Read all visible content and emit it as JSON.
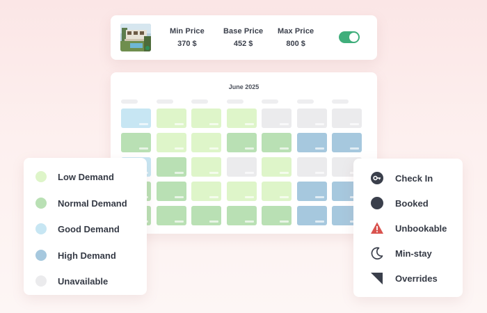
{
  "prices": {
    "min": {
      "label": "Min Price",
      "value": "370 $"
    },
    "base": {
      "label": "Base Price",
      "value": "452 $"
    },
    "max": {
      "label": "Max Price",
      "value": "800 $"
    },
    "toggle_on": true
  },
  "calendar": {
    "title": "June 2025",
    "rows": [
      [
        "good",
        "low",
        "low",
        "low",
        "unavailable",
        "unavailable",
        "unavailable"
      ],
      [
        "normal",
        "low",
        "low",
        "normal",
        "normal",
        "high",
        "high"
      ],
      [
        "good",
        "normal",
        "low",
        "unavailable",
        "low",
        "unavailable",
        "unavailable"
      ],
      [
        "normal",
        "normal",
        "low",
        "low",
        "low",
        "high",
        "high"
      ],
      [
        "normal",
        "normal",
        "normal",
        "normal",
        "normal",
        "high",
        "high"
      ]
    ]
  },
  "legend": {
    "demand": [
      {
        "key": "low",
        "label": "Low Demand",
        "color": "#def5c9"
      },
      {
        "key": "normal",
        "label": "Normal Demand",
        "color": "#b9e0b4"
      },
      {
        "key": "good",
        "label": "Good Demand",
        "color": "#c7e6f3"
      },
      {
        "key": "high",
        "label": "High Demand",
        "color": "#a6c8de"
      },
      {
        "key": "unavailable",
        "label": "Unavailable",
        "color": "#ebebed"
      }
    ],
    "status": [
      {
        "label": "Check In",
        "icon": "check-in-icon"
      },
      {
        "label": "Booked",
        "icon": "booked-icon"
      },
      {
        "label": "Unbookable",
        "icon": "warning-icon"
      },
      {
        "label": "Min-stay",
        "icon": "moon-icon"
      },
      {
        "label": "Overrides",
        "icon": "override-icon"
      }
    ]
  },
  "colors": {
    "toggle": "#3fae7b",
    "unbookable": "#d9534f",
    "icon_dark": "#3a3f4b"
  }
}
